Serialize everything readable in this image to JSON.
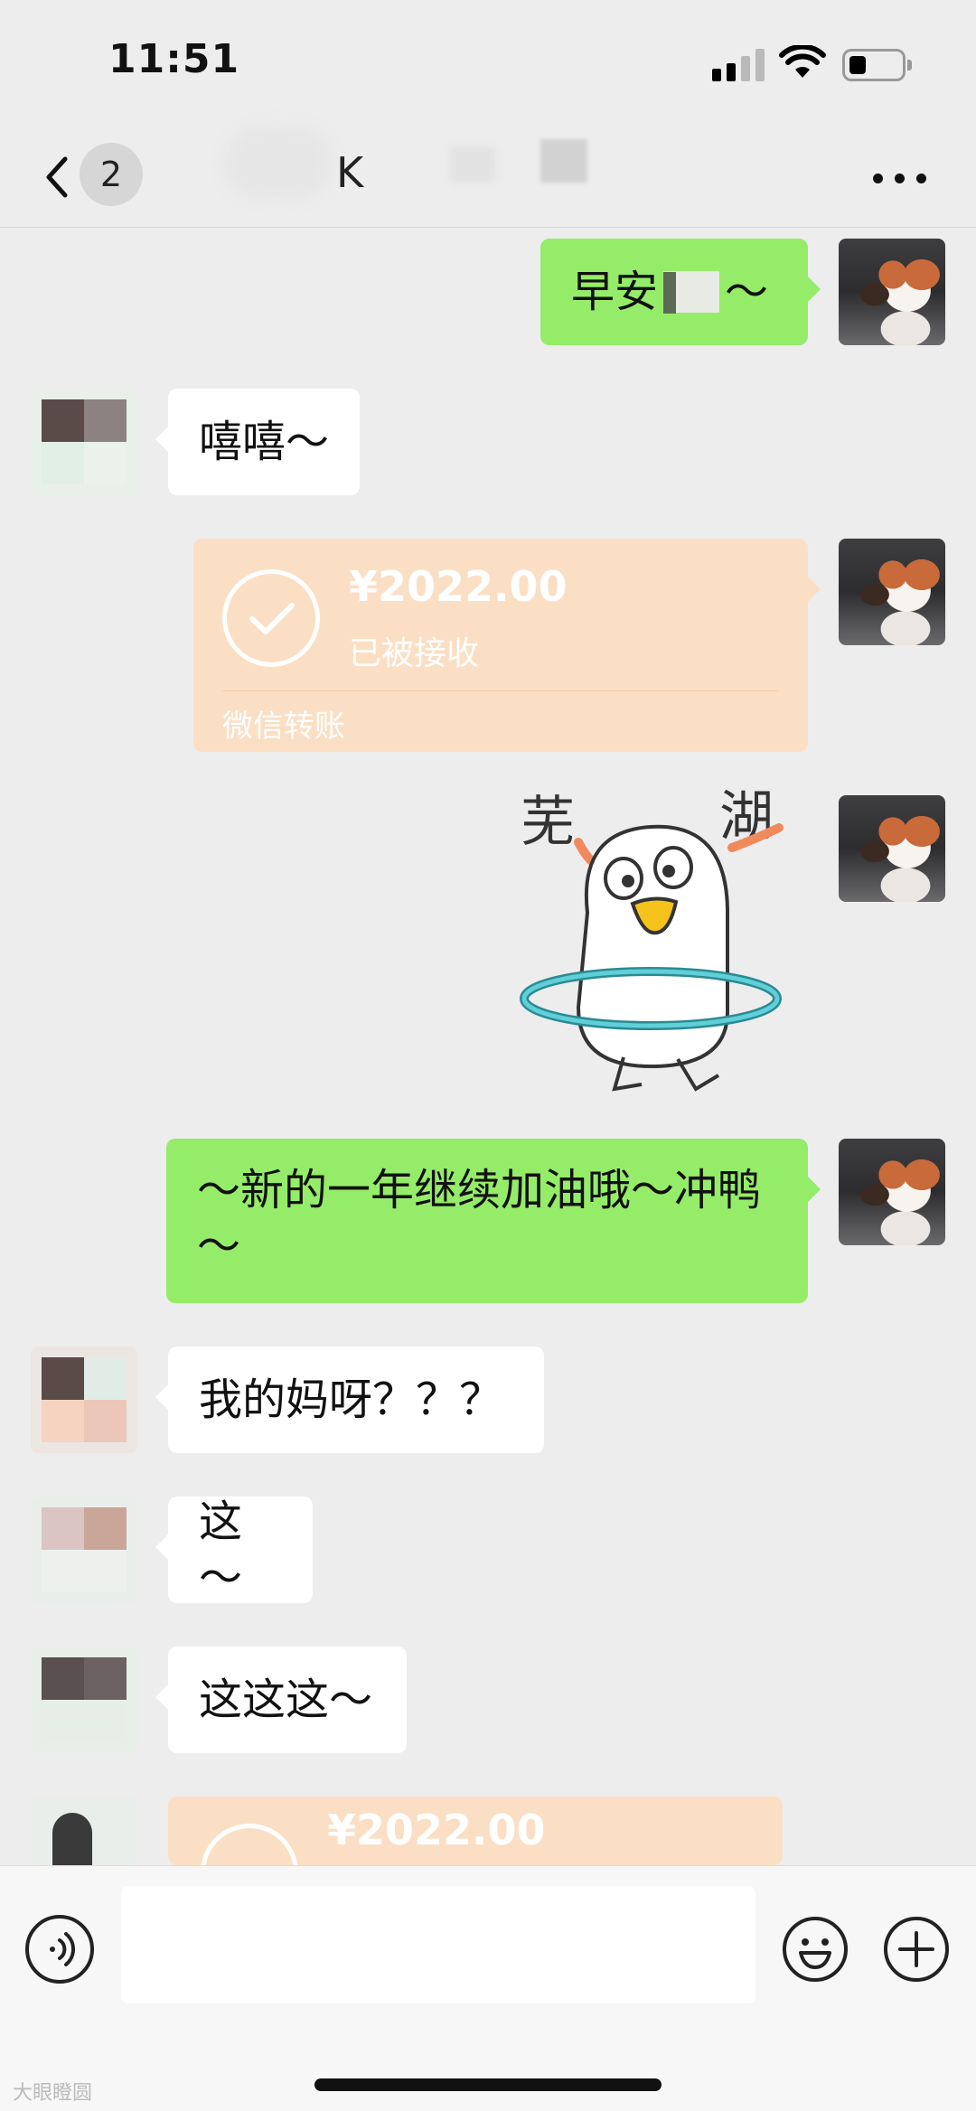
{
  "status_bar": {
    "time": "11:51"
  },
  "header": {
    "back_label": "Back",
    "unread_count": "2",
    "title": "K"
  },
  "messages": [
    {
      "side": "out",
      "type": "text",
      "text_before": "早安",
      "text_after": "～",
      "has_redaction": true
    },
    {
      "side": "in",
      "type": "text",
      "text": "嘻嘻～"
    },
    {
      "side": "out",
      "type": "transfer",
      "amount": "¥2022.00",
      "status": "已被接收",
      "label": "微信转账"
    },
    {
      "side": "out",
      "type": "sticker",
      "sticker_text_left": "芜",
      "sticker_text_right": "湖"
    },
    {
      "side": "out",
      "type": "text",
      "text": "～新的一年继续加油哦～冲鸭～"
    },
    {
      "side": "in",
      "type": "text",
      "text": "我的妈呀？？？"
    },
    {
      "side": "in",
      "type": "text",
      "text": "这～"
    },
    {
      "side": "in",
      "type": "text",
      "text": "这这这～"
    },
    {
      "side": "in",
      "type": "transfer",
      "amount": "¥2022.00"
    }
  ],
  "input_bar": {
    "placeholder": ""
  },
  "watermark": "大眼瞪圆",
  "colors": {
    "background": "#ededed",
    "outgoing_bubble": "#95ec69",
    "incoming_bubble": "#ffffff",
    "transfer_card": "#fbdfc4"
  },
  "icons": [
    "chevron-left-icon",
    "more-dots-icon",
    "voice-icon",
    "emoji-icon",
    "plus-icon",
    "check-icon",
    "signal-icon",
    "wifi-icon",
    "battery-icon"
  ]
}
